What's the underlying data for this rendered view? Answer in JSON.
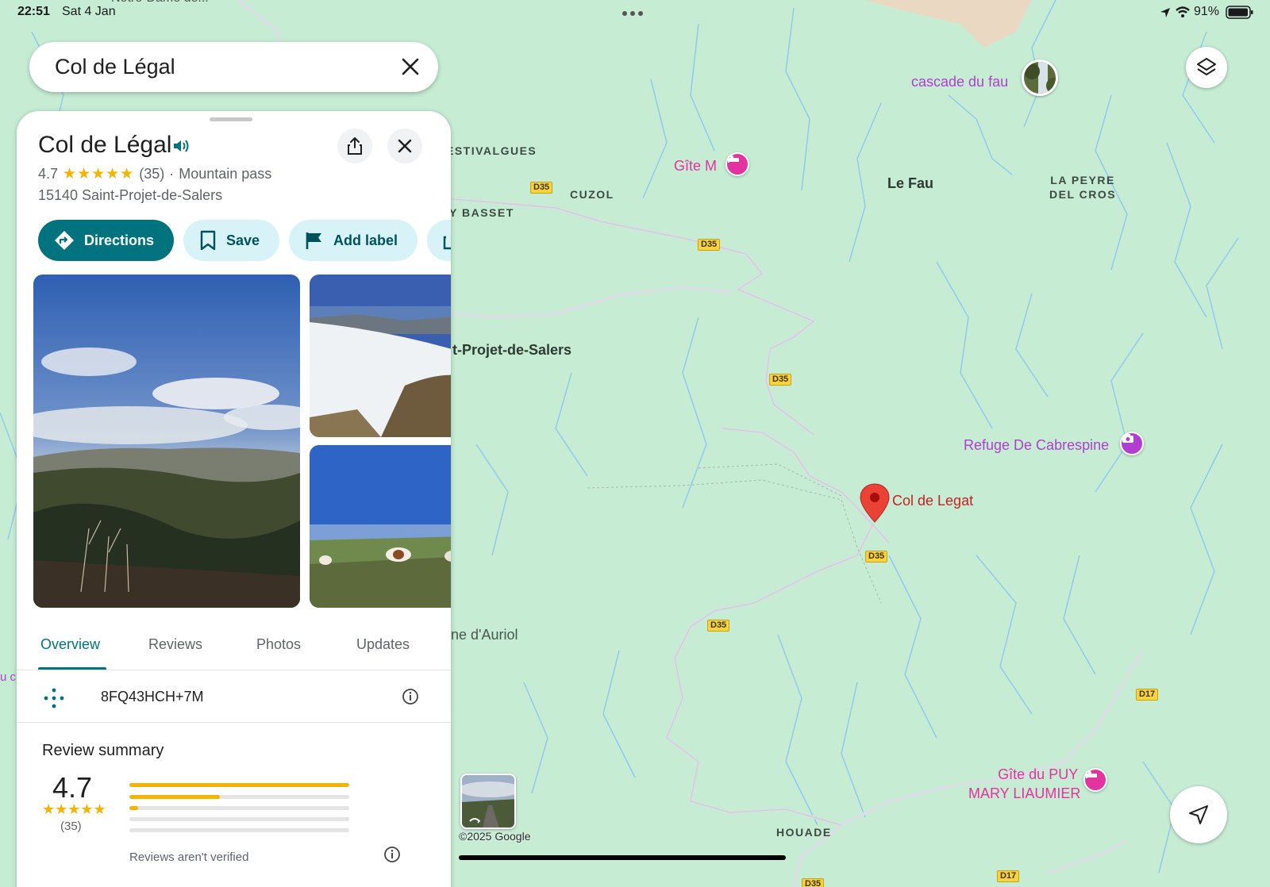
{
  "status_bar": {
    "time": "22:51",
    "date": "Sat 4 Jan",
    "battery": "91%"
  },
  "search": {
    "query": "Col de Légal"
  },
  "place": {
    "title": "Col de Légal",
    "rating": "4.7",
    "stars": "★★★★★",
    "review_count": "(35)",
    "separator": "·",
    "category": "Mountain pass",
    "address": "15140 Saint-Projet-de-Salers"
  },
  "actions": {
    "directions": "Directions",
    "save": "Save",
    "add_label": "Add label"
  },
  "tabs": [
    {
      "label": "Overview"
    },
    {
      "label": "Reviews"
    },
    {
      "label": "Photos"
    },
    {
      "label": "Updates"
    }
  ],
  "plus_code": "8FQ43HCH+7M",
  "review_summary": {
    "title": "Review summary",
    "rating": "4.7",
    "stars": "★★★★★",
    "count": "(35)",
    "distribution": [
      1.0,
      0.41,
      0.04,
      0.0,
      0.0
    ],
    "note": "Reviews aren't verified"
  },
  "map": {
    "labels": {
      "notre_dame": "Notre-Dame de...",
      "estivalgues": "ESTIVALGUES",
      "cuzol": "CUZOL",
      "puy_basset": "Y BASSET",
      "saint_projet": "t-Projet-de-Salers",
      "auriol": "ne d'Auriol",
      "le_fau": "Le Fau",
      "la_peyre_1": "LA PEYRE",
      "la_peyre_2": "DEL CROS",
      "houade": "HOUADE",
      "left_edge": "u c"
    },
    "pois": {
      "cascade": "cascade du fau",
      "gite_m": "Gîte M",
      "refuge": "Refuge De Cabrespine",
      "col_de_legat": "Col de Legat",
      "gite_puy_1": "Gîte du PUY",
      "gite_puy_2": "MARY LIAUMIER"
    },
    "roads": {
      "d35": "D35",
      "d17": "D17"
    },
    "copyright": "©2025 Google"
  },
  "colors": {
    "accent": "#00737f",
    "chip_bg": "#d8f3f8",
    "star": "#f4b400",
    "map_bg": "#c6ecd4",
    "pin": "#ea4335",
    "poi_purple": "#b03fd1",
    "lodging_pink": "#e4339e"
  }
}
